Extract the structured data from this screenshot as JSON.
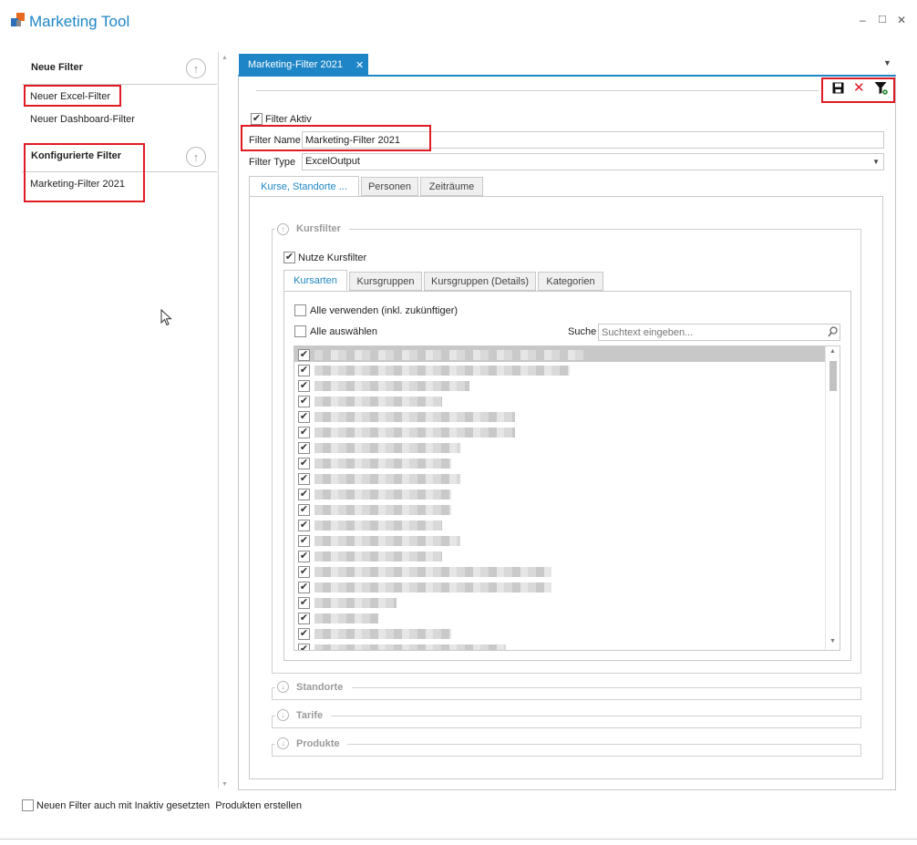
{
  "window": {
    "title": "Marketing Tool",
    "controls": {
      "minimize": "–",
      "maximize": "□",
      "close": "✕"
    }
  },
  "sidebar": {
    "new_filter_header": "Neue Filter",
    "new_filter_items": [
      "Neuer Excel-Filter",
      "Neuer Dashboard-Filter"
    ],
    "configured_header": "Konfigurierte Filter",
    "configured_items": [
      "Marketing-Filter 2021"
    ],
    "bottom_checkbox_label": "Neuen Filter auch mit Inaktiv gesetzten  Produkten erstellen"
  },
  "document_tab": {
    "label": "Marketing-Filter 2021",
    "close": "✕"
  },
  "toolbar": {
    "save_icon": "save-icon",
    "delete_icon": "delete-icon",
    "filter_icon": "filter-settings-icon"
  },
  "form": {
    "filter_active_label": "Filter Aktiv",
    "filter_name_label": "Filter Name",
    "filter_name_value": "Marketing-Filter 2021",
    "filter_type_label": "Filter Type",
    "filter_type_value": "ExcelOutput"
  },
  "main_tabs": [
    "Kurse, Standorte ...",
    "Personen",
    "Zeiträume"
  ],
  "kursfilter": {
    "title": "Kursfilter",
    "use_label": "Nutze Kursfilter",
    "tabs": [
      "Kursarten",
      "Kursgruppen",
      "Kursgruppen (Details)",
      "Kategorien"
    ],
    "use_all_label": "Alle verwenden (inkl. zukünftiger)",
    "select_all_label": "Alle auswählen",
    "search_label": "Suche",
    "search_placeholder": "Suchtext eingeben..."
  },
  "collapsed_groups": [
    "Standorte",
    "Tarife",
    "Produkte"
  ],
  "colors": {
    "accent": "#1e86c6",
    "highlight": "#e01b24"
  }
}
